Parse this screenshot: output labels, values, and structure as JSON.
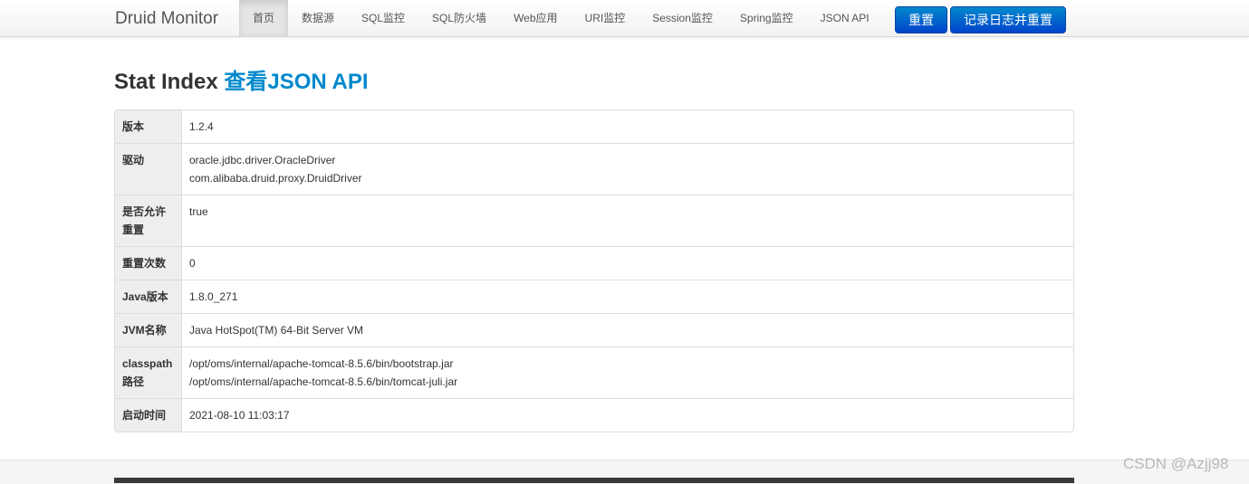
{
  "navbar": {
    "brand": "Druid Monitor",
    "items": [
      {
        "label": "首页",
        "active": true
      },
      {
        "label": "数据源"
      },
      {
        "label": "SQL监控"
      },
      {
        "label": "SQL防火墙"
      },
      {
        "label": "Web应用"
      },
      {
        "label": "URI监控"
      },
      {
        "label": "Session监控"
      },
      {
        "label": "Spring监控"
      },
      {
        "label": "JSON API"
      }
    ],
    "reset_button": "重置",
    "log_reset_button": "记录日志并重置"
  },
  "title": {
    "text": "Stat Index",
    "link": "查看JSON API"
  },
  "stats": [
    {
      "label": "版本",
      "values": [
        "1.2.4"
      ]
    },
    {
      "label": "驱动",
      "values": [
        "oracle.jdbc.driver.OracleDriver",
        "com.alibaba.druid.proxy.DruidDriver"
      ]
    },
    {
      "label": "是否允许重置",
      "values": [
        "true"
      ]
    },
    {
      "label": "重置次数",
      "values": [
        "0"
      ]
    },
    {
      "label": "Java版本",
      "values": [
        "1.8.0_271"
      ]
    },
    {
      "label": "JVM名称",
      "values": [
        "Java HotSpot(TM) 64-Bit Server VM"
      ]
    },
    {
      "label": "classpath路径",
      "values": [
        "/opt/oms/internal/apache-tomcat-8.5.6/bin/bootstrap.jar",
        "/opt/oms/internal/apache-tomcat-8.5.6/bin/tomcat-juli.jar"
      ]
    },
    {
      "label": "启动时间",
      "values": [
        "2021-08-10 11:03:17"
      ]
    }
  ],
  "watermark": "CSDN @Azjj98",
  "colors": {
    "accent": "#0088cc",
    "button_top": "#0088cc",
    "button_bottom": "#0044cc",
    "label_bg": "#eeeeee"
  }
}
